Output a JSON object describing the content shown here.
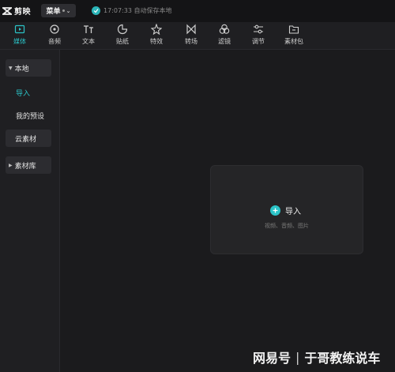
{
  "app": {
    "logo_text": "剪映"
  },
  "titlebar": {
    "menu_label": "菜单",
    "save_status": "17:07:33 自动保存本地"
  },
  "toolbar": {
    "items": [
      {
        "label": "媒体",
        "icon": "media-icon",
        "active": true
      },
      {
        "label": "音频",
        "icon": "audio-icon"
      },
      {
        "label": "文本",
        "icon": "text-icon"
      },
      {
        "label": "贴纸",
        "icon": "sticker-icon"
      },
      {
        "label": "特效",
        "icon": "effects-icon"
      },
      {
        "label": "转场",
        "icon": "transition-icon"
      },
      {
        "label": "滤镜",
        "icon": "filter-icon"
      },
      {
        "label": "调节",
        "icon": "adjust-icon"
      },
      {
        "label": "素材包",
        "icon": "package-icon"
      }
    ],
    "accent_color": "#2bc3c7"
  },
  "sidebar": {
    "local": "本地",
    "import": "导入",
    "presets": "我的预设",
    "cloud": "云素材",
    "library": "素材库"
  },
  "import_panel": {
    "label": "导入",
    "hint": "视频、音频、图片"
  },
  "watermark": {
    "left": "网易号",
    "right": "于哥教练说车"
  }
}
